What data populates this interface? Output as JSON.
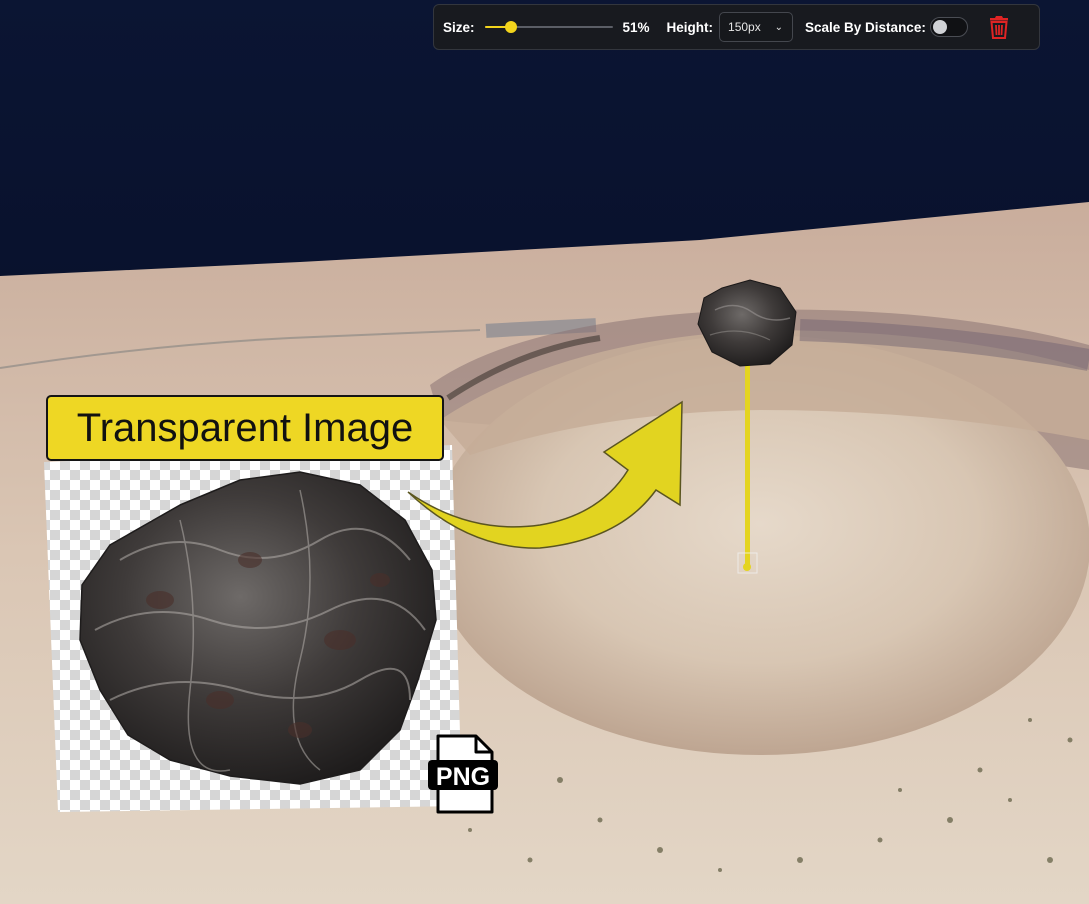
{
  "toolbar": {
    "size_label": "Size:",
    "size_value": 51,
    "size_display": "51%",
    "height_label": "Height:",
    "height_value": "150px",
    "scale_label": "Scale By Distance:",
    "scale_enabled": false
  },
  "callout": {
    "title": "Transparent Image",
    "file_badge": "PNG"
  },
  "colors": {
    "accent": "#f2d41c",
    "callout_yellow": "#eed724",
    "delete_red": "#e02424",
    "toolbar_bg": "#181a1f"
  },
  "icons": {
    "dropdown": "chevron-down-icon",
    "delete": "trash-icon",
    "file": "png-file-icon"
  }
}
